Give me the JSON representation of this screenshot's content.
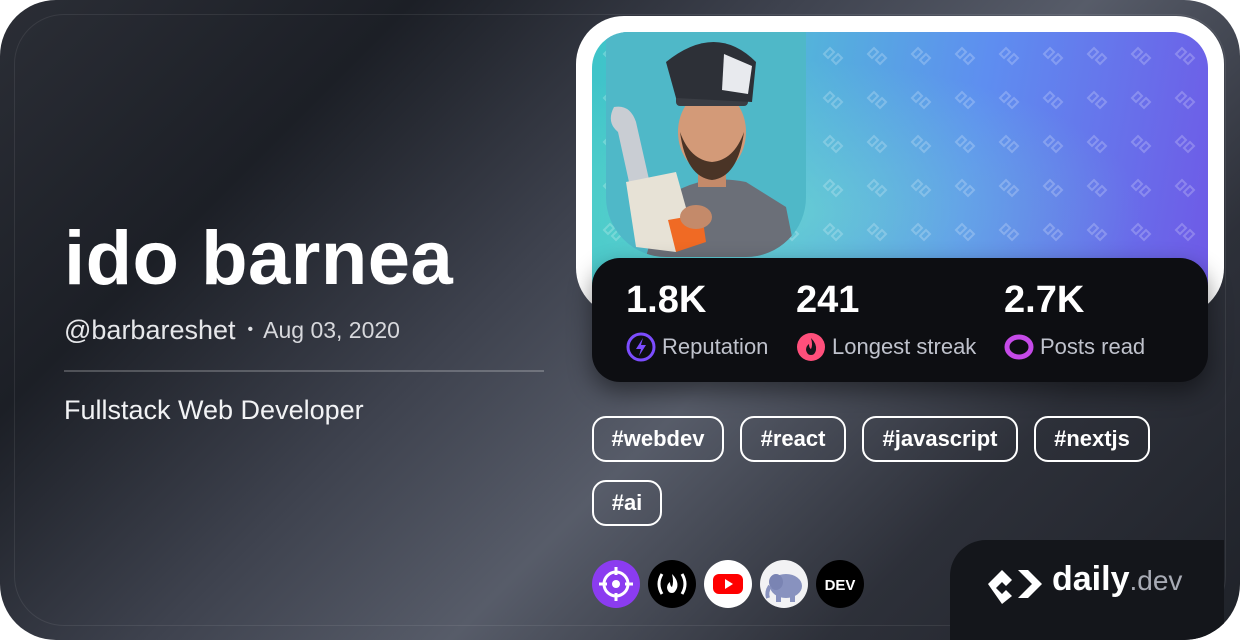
{
  "profile": {
    "name": "ido barnea",
    "handle": "@barbareshet",
    "separator": "•",
    "joined": "Aug 03, 2020",
    "bio": "Fullstack Web Developer"
  },
  "stats": [
    {
      "value": "1.8K",
      "label": "Reputation",
      "icon": "lightning-icon",
      "color": "#7c4dff"
    },
    {
      "value": "241",
      "label": "Longest streak",
      "icon": "flame-icon",
      "color": "#ff4f7b"
    },
    {
      "value": "2.7K",
      "label": "Posts read",
      "icon": "eye-ring-icon",
      "color": "#c54ae8"
    }
  ],
  "tags": [
    "#webdev",
    "#react",
    "#javascript",
    "#nextjs",
    "#ai"
  ],
  "squads": [
    {
      "icon": "crosshair-icon",
      "color": "#8b3cf0"
    },
    {
      "icon": "freecodecamp-icon",
      "color": "#000000"
    },
    {
      "icon": "youtube-icon",
      "color": "#ffffff"
    },
    {
      "icon": "php-elephant-icon",
      "color": "#f2f2f4"
    },
    {
      "icon": "dev-icon",
      "color": "#000000"
    }
  ],
  "dev_badge": "DEV",
  "brand": {
    "daily": "daily",
    "dev": ".dev"
  }
}
